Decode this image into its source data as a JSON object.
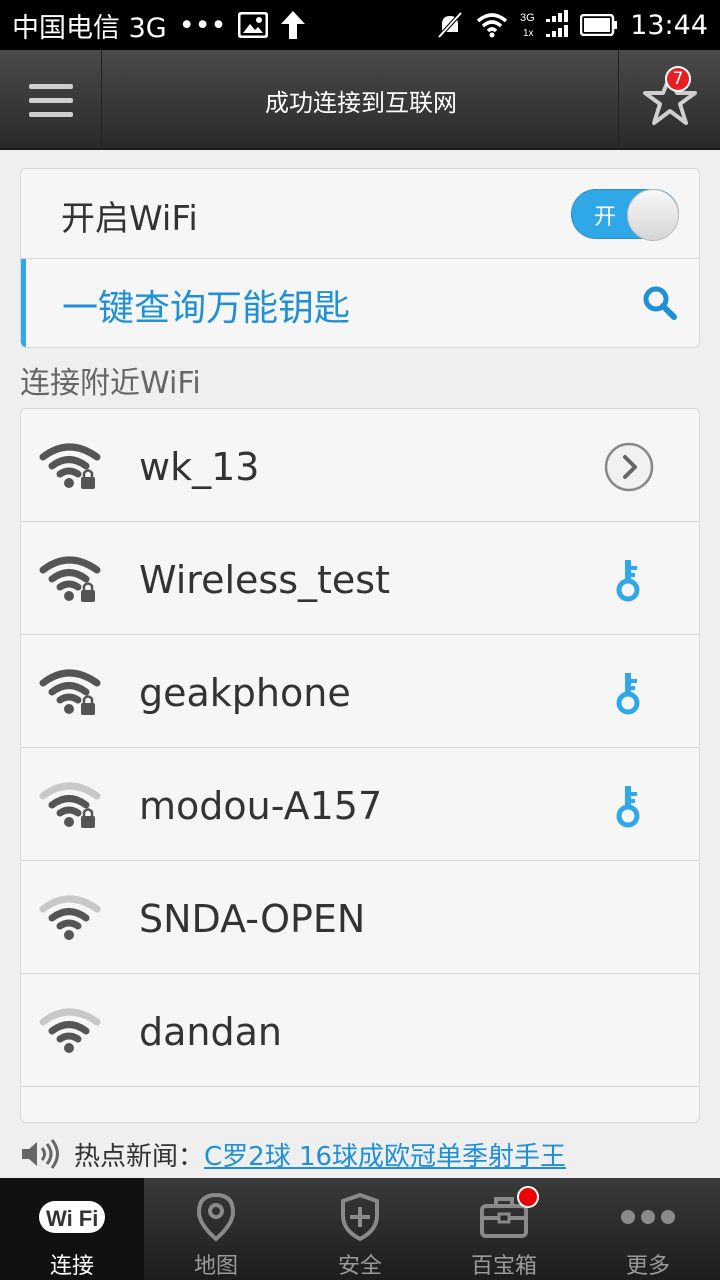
{
  "status_bar": {
    "carrier": "中国电信 3G",
    "dots": "•••",
    "time": "13:44",
    "network_label_top": "3G",
    "network_label_bottom": "1x"
  },
  "header": {
    "title": "成功连接到互联网",
    "badge_count": "7"
  },
  "wifi_toggle": {
    "label": "开启WiFi",
    "state_text": "开",
    "enabled": true
  },
  "query": {
    "label": "一键查询万能钥匙"
  },
  "section": {
    "label": "连接附近WiFi"
  },
  "networks": [
    {
      "name": "wk_13",
      "locked": true,
      "signal": "strong",
      "action": "chevron-right-icon"
    },
    {
      "name": "Wireless_test",
      "locked": true,
      "signal": "strong",
      "action": "key-icon"
    },
    {
      "name": "geakphone",
      "locked": true,
      "signal": "strong",
      "action": "key-icon"
    },
    {
      "name": "modou-A157",
      "locked": true,
      "signal": "medium",
      "action": "key-icon"
    },
    {
      "name": "SNDA-OPEN",
      "locked": false,
      "signal": "medium",
      "action": ""
    },
    {
      "name": "dandan",
      "locked": false,
      "signal": "medium",
      "action": ""
    }
  ],
  "news": {
    "prefix": "热点新闻：",
    "headline": "C罗2球 16球成欧冠单季射手王"
  },
  "bottom_nav": [
    {
      "label": "连接",
      "icon": "wifi-logo-icon",
      "active": true,
      "logo_text": "Wi Fi"
    },
    {
      "label": "地图",
      "icon": "map-pin-icon",
      "active": false
    },
    {
      "label": "安全",
      "icon": "shield-icon",
      "active": false
    },
    {
      "label": "百宝箱",
      "icon": "toolbox-icon",
      "active": false,
      "dot": true
    },
    {
      "label": "更多",
      "icon": "more-dots-icon",
      "active": false
    }
  ],
  "colors": {
    "accent": "#30a7e6",
    "link": "#1f8fd6",
    "badge": "#e62020"
  }
}
